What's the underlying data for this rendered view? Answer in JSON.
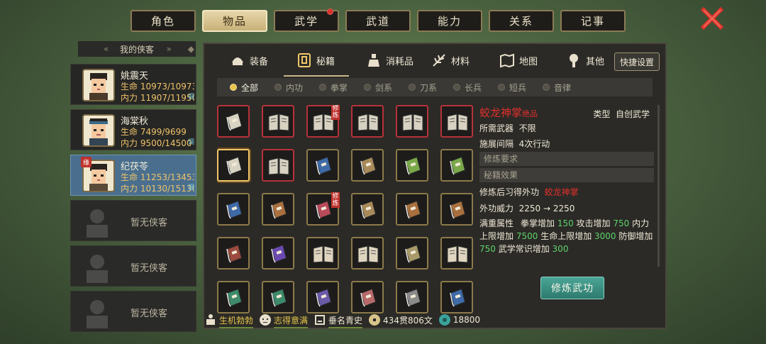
{
  "top_tabs": [
    "角色",
    "物品",
    "武学",
    "武道",
    "能力",
    "关系",
    "记事"
  ],
  "active_top_tab": 1,
  "left_panel": {
    "title": "我的侠客",
    "heroes": [
      {
        "name": "姚震天",
        "hp": "生命 10973/10973",
        "mp": "内力 11907/11950",
        "tag": "调"
      },
      {
        "name": "海棠秋",
        "hp": "生命 7499/9699",
        "mp": "内力 9500/14500",
        "tag": "调"
      },
      {
        "name": "纪茯苓",
        "hp": "生命 11253/13453",
        "mp": "内力 10130/15130",
        "tag": "调",
        "badge": "缘"
      }
    ],
    "empty_label": "暂无侠客"
  },
  "sub_tabs": [
    {
      "label": "装备",
      "icon": "helmet-icon"
    },
    {
      "label": "秘籍",
      "icon": "book-icon"
    },
    {
      "label": "消耗品",
      "icon": "potion-icon"
    },
    {
      "label": "材料",
      "icon": "herb-icon"
    },
    {
      "label": "地图",
      "icon": "map-icon"
    },
    {
      "label": "其他",
      "icon": "misc-icon"
    }
  ],
  "active_sub_tab": 1,
  "quick_settings": "快捷设置",
  "filters": [
    "全部",
    "内功",
    "拳掌",
    "剑系",
    "刀系",
    "长兵",
    "短兵",
    "音律"
  ],
  "active_filter": 0,
  "item_lock_label": "修炼",
  "detail": {
    "name": "蛟龙神掌",
    "grade": "绝品",
    "type_label": "类型",
    "type_value": "自创武学",
    "weapon_label": "所需武器",
    "weapon_value": "不限",
    "interval_label": "施展间隔",
    "interval_value": "4次行动",
    "req_header": "修炼要求",
    "effect_header": "秘籍效果",
    "learn_label": "修炼后习得外功",
    "learn_value": "蛟龙神掌",
    "power_label": "外功威力",
    "power_value": "2250 → 2250",
    "full_label": "满重属性",
    "attr_parts": [
      {
        "t": "拳掌增加 ",
        "c": "w"
      },
      {
        "t": "150",
        "c": "g"
      },
      {
        "t": " 攻击增加 ",
        "c": "w"
      },
      {
        "t": "750",
        "c": "g"
      },
      {
        "t": " 内力上限增加 ",
        "c": "w"
      },
      {
        "t": "7500",
        "c": "g"
      },
      {
        "t": " 生命上限增加 ",
        "c": "w"
      },
      {
        "t": "3000",
        "c": "g"
      },
      {
        "t": " 防御增加 ",
        "c": "w"
      },
      {
        "t": "750",
        "c": "g"
      },
      {
        "t": " 武学常识增加 ",
        "c": "w"
      },
      {
        "t": "300",
        "c": "g"
      }
    ],
    "train_button": "修炼武功"
  },
  "status_bar": {
    "vitality": "生机勃勃",
    "mood": "志得意满",
    "fame": "垂名青史",
    "money": "434贯806文",
    "jade": "18800"
  }
}
